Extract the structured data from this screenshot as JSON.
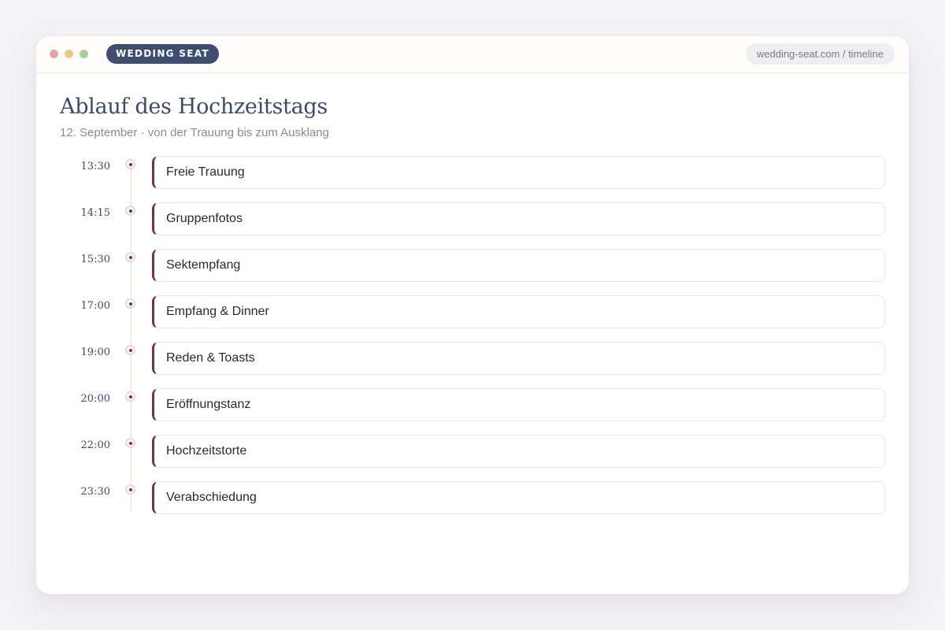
{
  "window": {
    "brand": "WEDDING SEAT",
    "url": "wedding-seat.com / timeline"
  },
  "page": {
    "title": "Ablauf des Hochzeitstags",
    "subtitle": "12. September · von der Trauung bis zum Ausklang"
  },
  "events": [
    {
      "time": "13:30",
      "title": "Freie Trauung"
    },
    {
      "time": "14:15",
      "title": "Gruppenfotos"
    },
    {
      "time": "15:30",
      "title": "Sektempfang"
    },
    {
      "time": "17:00",
      "title": "Empfang & Dinner"
    },
    {
      "time": "19:00",
      "title": "Reden & Toasts"
    },
    {
      "time": "20:00",
      "title": "Eröffnungstanz"
    },
    {
      "time": "22:00",
      "title": "Hochzeitstorte"
    },
    {
      "time": "23:30",
      "title": "Verabschiedung"
    }
  ],
  "colors": {
    "accent": "#7c2d4a",
    "brand": "#3f4d70",
    "background": "#f3f3f6"
  }
}
